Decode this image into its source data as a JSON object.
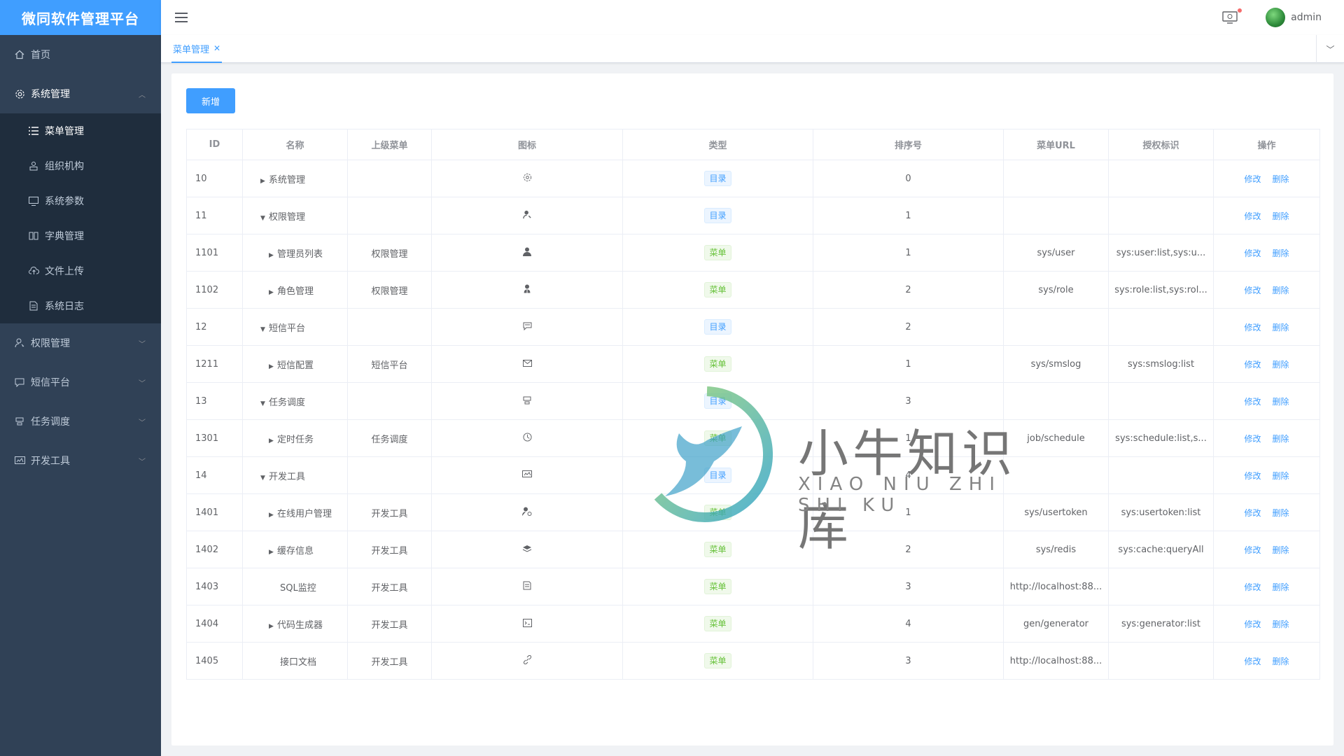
{
  "app": {
    "title": "微同软件管理平台"
  },
  "sidebar": {
    "home": "首页",
    "system": "系统管理",
    "system_items": [
      "菜单管理",
      "组织机构",
      "系统参数",
      "字典管理",
      "文件上传",
      "系统日志"
    ],
    "groups": [
      "权限管理",
      "短信平台",
      "任务调度",
      "开发工具"
    ]
  },
  "navbar": {
    "username": "admin"
  },
  "tags": {
    "active": "菜单管理"
  },
  "toolbar": {
    "add_label": "新增"
  },
  "table": {
    "headers": [
      "ID",
      "名称",
      "上级菜单",
      "图标",
      "类型",
      "排序号",
      "菜单URL",
      "授权标识",
      "操作"
    ],
    "edit_label": "修改",
    "delete_label": "删除",
    "rows": [
      {
        "id": "10",
        "name": "系统管理",
        "parent": "",
        "icon": "gear-icon",
        "type": "目录",
        "type_kind": "dir",
        "order": "0",
        "url": "",
        "perms": "",
        "caret": "right",
        "indent": 0
      },
      {
        "id": "11",
        "name": "权限管理",
        "parent": "",
        "icon": "user-key-icon",
        "type": "目录",
        "type_kind": "dir",
        "order": "1",
        "url": "",
        "perms": "",
        "caret": "down",
        "indent": 0
      },
      {
        "id": "1101",
        "name": "管理员列表",
        "parent": "权限管理",
        "icon": "user-icon",
        "type": "菜单",
        "type_kind": "menu",
        "order": "1",
        "url": "sys/user",
        "perms": "sys:user:list,sys:u...",
        "caret": "right",
        "indent": 1
      },
      {
        "id": "1102",
        "name": "角色管理",
        "parent": "权限管理",
        "icon": "role-icon",
        "type": "菜单",
        "type_kind": "menu",
        "order": "2",
        "url": "sys/role",
        "perms": "sys:role:list,sys:rol...",
        "caret": "right",
        "indent": 1
      },
      {
        "id": "12",
        "name": "短信平台",
        "parent": "",
        "icon": "message-icon",
        "type": "目录",
        "type_kind": "dir",
        "order": "2",
        "url": "",
        "perms": "",
        "caret": "down",
        "indent": 0
      },
      {
        "id": "1211",
        "name": "短信配置",
        "parent": "短信平台",
        "icon": "mail-icon",
        "type": "菜单",
        "type_kind": "menu",
        "order": "1",
        "url": "sys/smslog",
        "perms": "sys:smslog:list",
        "caret": "right",
        "indent": 1
      },
      {
        "id": "13",
        "name": "任务调度",
        "parent": "",
        "icon": "task-icon",
        "type": "目录",
        "type_kind": "dir",
        "order": "3",
        "url": "",
        "perms": "",
        "caret": "down",
        "indent": 0
      },
      {
        "id": "1301",
        "name": "定时任务",
        "parent": "任务调度",
        "icon": "clock-icon",
        "type": "菜单",
        "type_kind": "menu",
        "order": "1",
        "url": "job/schedule",
        "perms": "sys:schedule:list,s...",
        "caret": "right",
        "indent": 1
      },
      {
        "id": "14",
        "name": "开发工具",
        "parent": "",
        "icon": "monitor-icon",
        "type": "目录",
        "type_kind": "dir",
        "order": "4",
        "url": "",
        "perms": "",
        "caret": "down",
        "indent": 0
      },
      {
        "id": "1401",
        "name": "在线用户管理",
        "parent": "开发工具",
        "icon": "online-user-icon",
        "type": "菜单",
        "type_kind": "menu",
        "order": "1",
        "url": "sys/usertoken",
        "perms": "sys:usertoken:list",
        "caret": "right",
        "indent": 1
      },
      {
        "id": "1402",
        "name": "缓存信息",
        "parent": "开发工具",
        "icon": "layers-icon",
        "type": "菜单",
        "type_kind": "menu",
        "order": "2",
        "url": "sys/redis",
        "perms": "sys:cache:queryAll",
        "caret": "right",
        "indent": 1
      },
      {
        "id": "1403",
        "name": "SQL监控",
        "parent": "开发工具",
        "icon": "sql-icon",
        "type": "菜单",
        "type_kind": "menu",
        "order": "3",
        "url": "http://localhost:88...",
        "perms": "",
        "caret": "none",
        "indent": 1
      },
      {
        "id": "1404",
        "name": "代码生成器",
        "parent": "开发工具",
        "icon": "code-icon",
        "type": "菜单",
        "type_kind": "menu",
        "order": "4",
        "url": "gen/generator",
        "perms": "sys:generator:list",
        "caret": "right",
        "indent": 1
      },
      {
        "id": "1405",
        "name": "接口文档",
        "parent": "开发工具",
        "icon": "link-icon",
        "type": "菜单",
        "type_kind": "menu",
        "order": "3",
        "url": "http://localhost:88...",
        "perms": "",
        "caret": "none",
        "indent": 1
      }
    ]
  },
  "watermark": {
    "text": "小牛知识库",
    "sub": "XIAO NIU ZHI SHI KU"
  },
  "colors": {
    "primary": "#409eff",
    "sidebar": "#304156",
    "success": "#67c23a"
  }
}
